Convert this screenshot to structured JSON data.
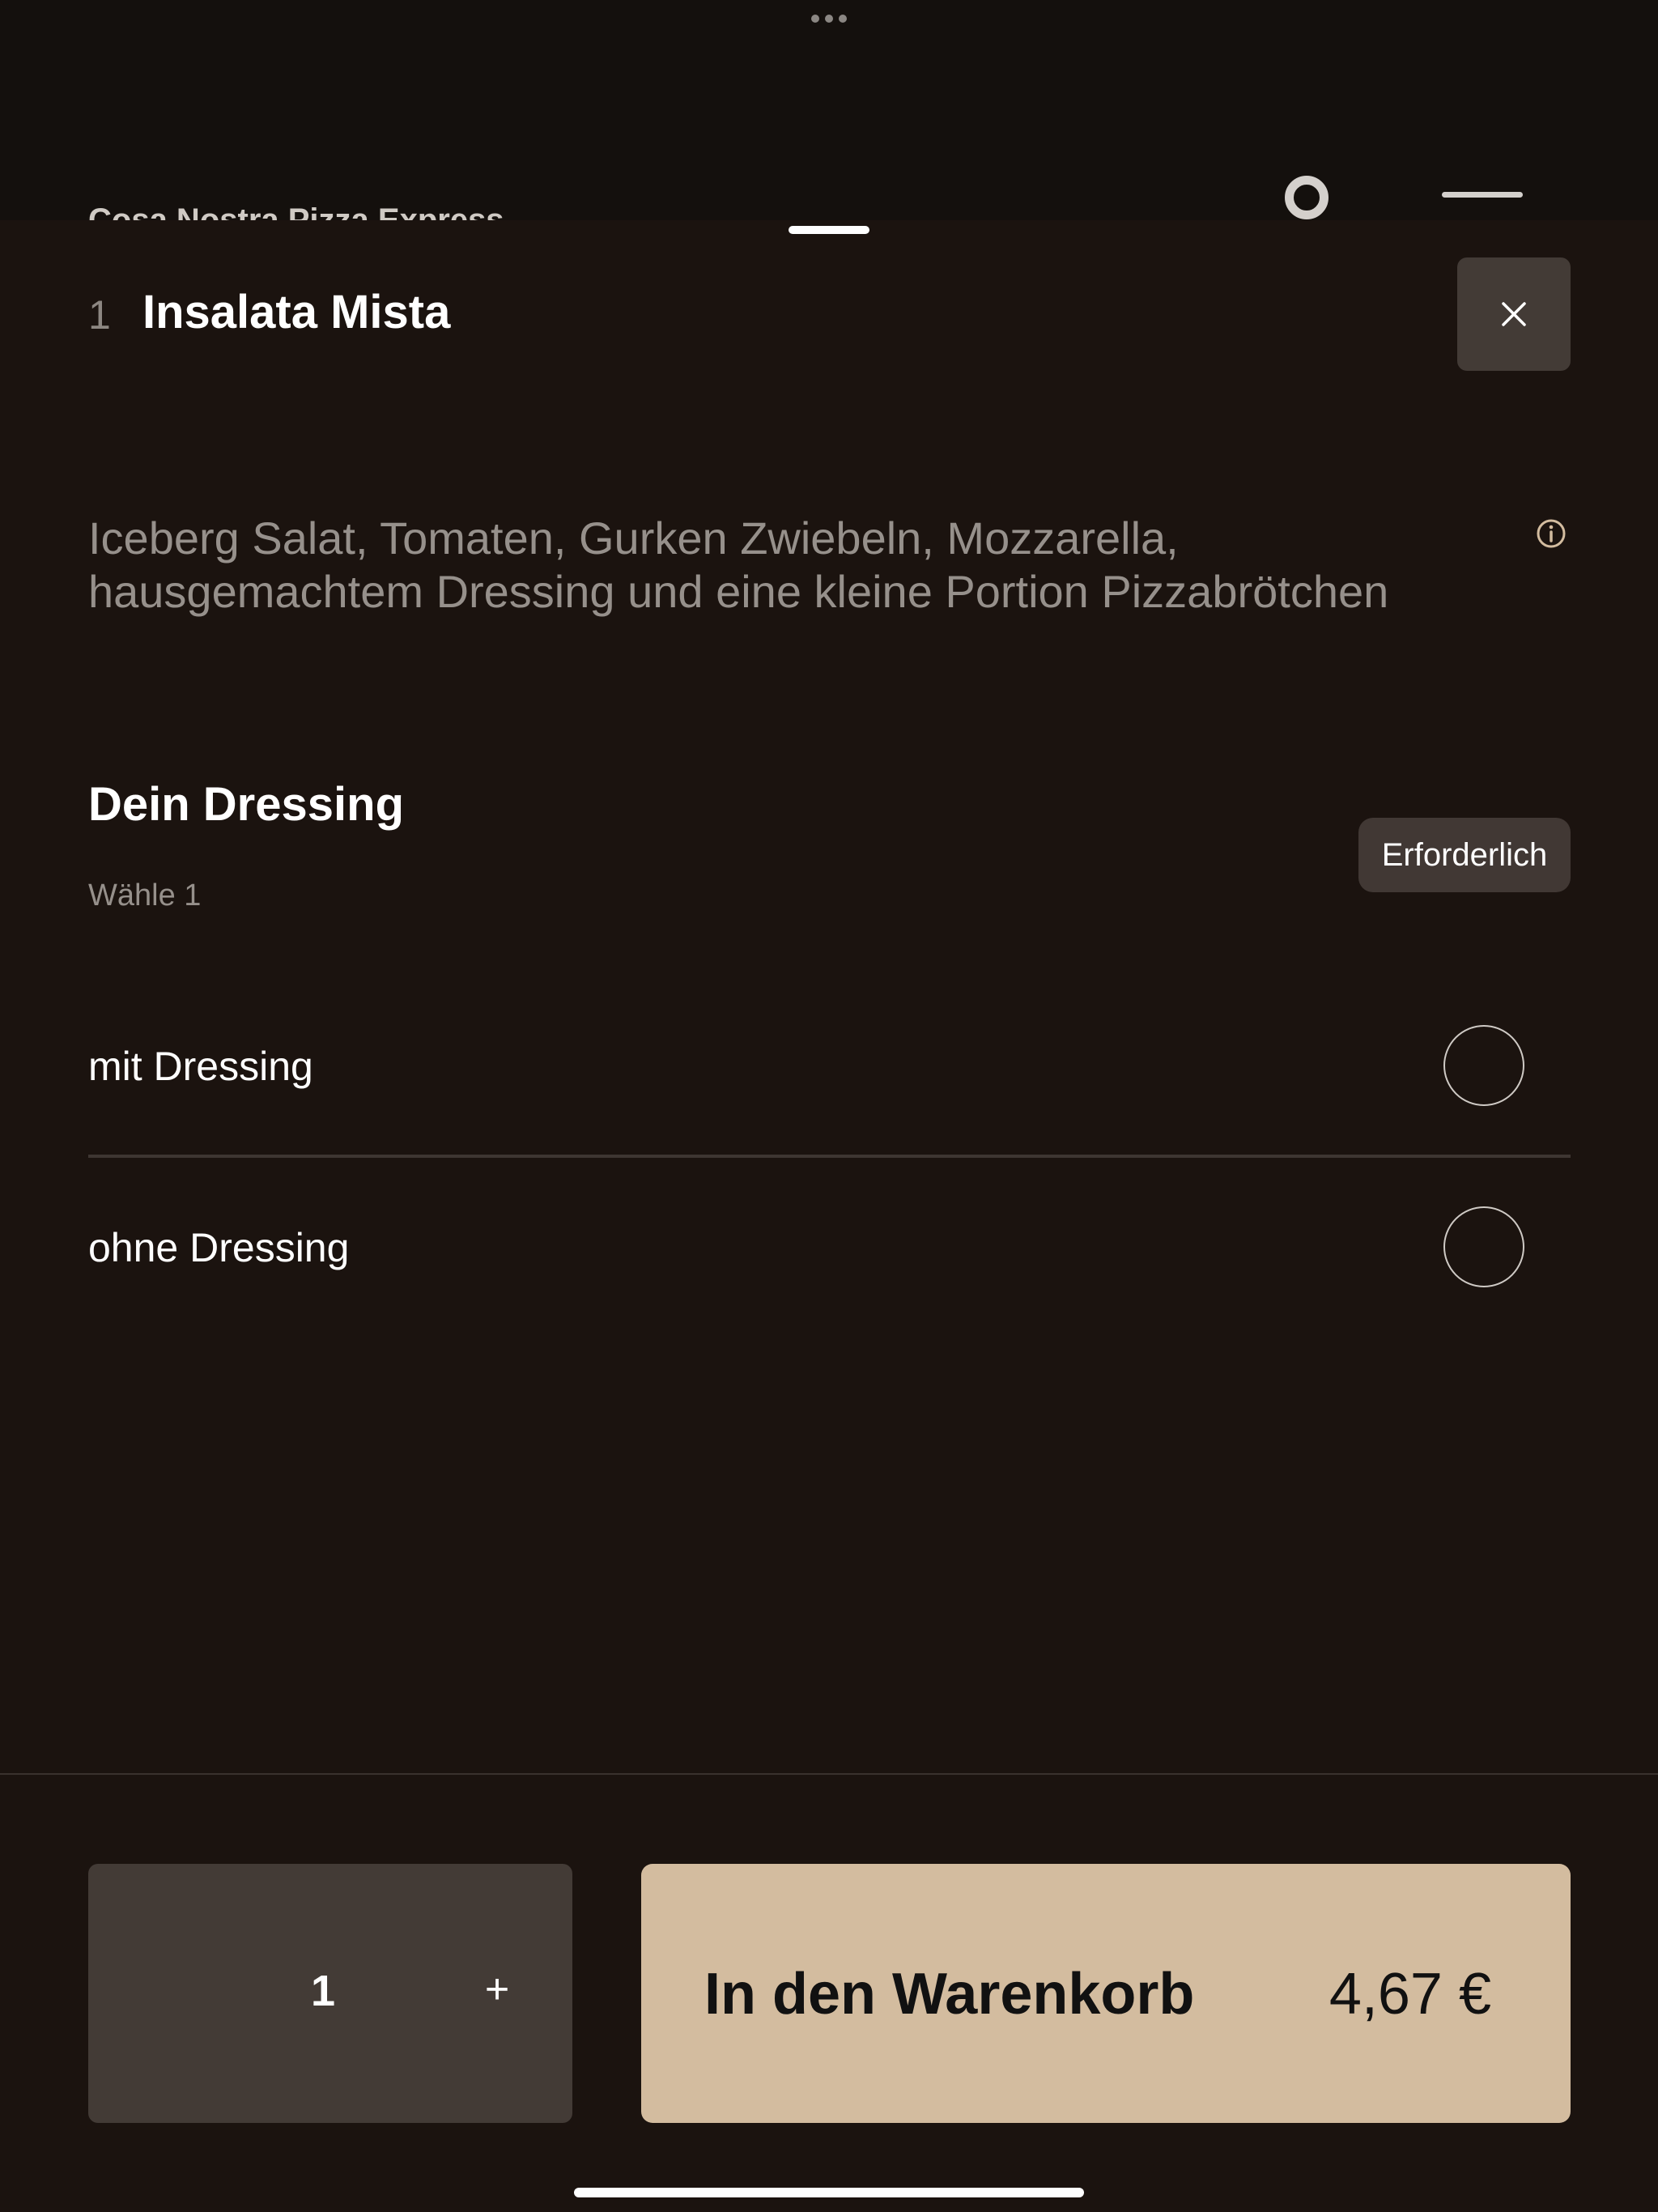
{
  "background": {
    "restaurant_name": "Cosa Nostra Pizza Express",
    "icons": [
      "circle-icon",
      "menu-icon"
    ]
  },
  "item": {
    "number": "1",
    "title": "Insalata Mista",
    "description": "Iceberg Salat, Tomaten, Gurken Zwiebeln, Mozzarella, hausgemachtem Dressing und eine kleine Portion Pizzabrötchen"
  },
  "dressing_group": {
    "title": "Dein Dressing",
    "subtitle": "Wähle 1",
    "badge": "Erforderlich",
    "options": [
      {
        "label": "mit Dressing",
        "selected": false
      },
      {
        "label": "ohne Dressing",
        "selected": false
      }
    ]
  },
  "footer": {
    "quantity": "1",
    "plus_label": "+",
    "cart_label": "In den Warenkorb",
    "price": "4,67 €"
  },
  "colors": {
    "background": "#13100d",
    "sheet": "#1b130f",
    "button_dark": "#433b36",
    "accent": "#d3bc9f",
    "muted_text": "#96908b"
  }
}
